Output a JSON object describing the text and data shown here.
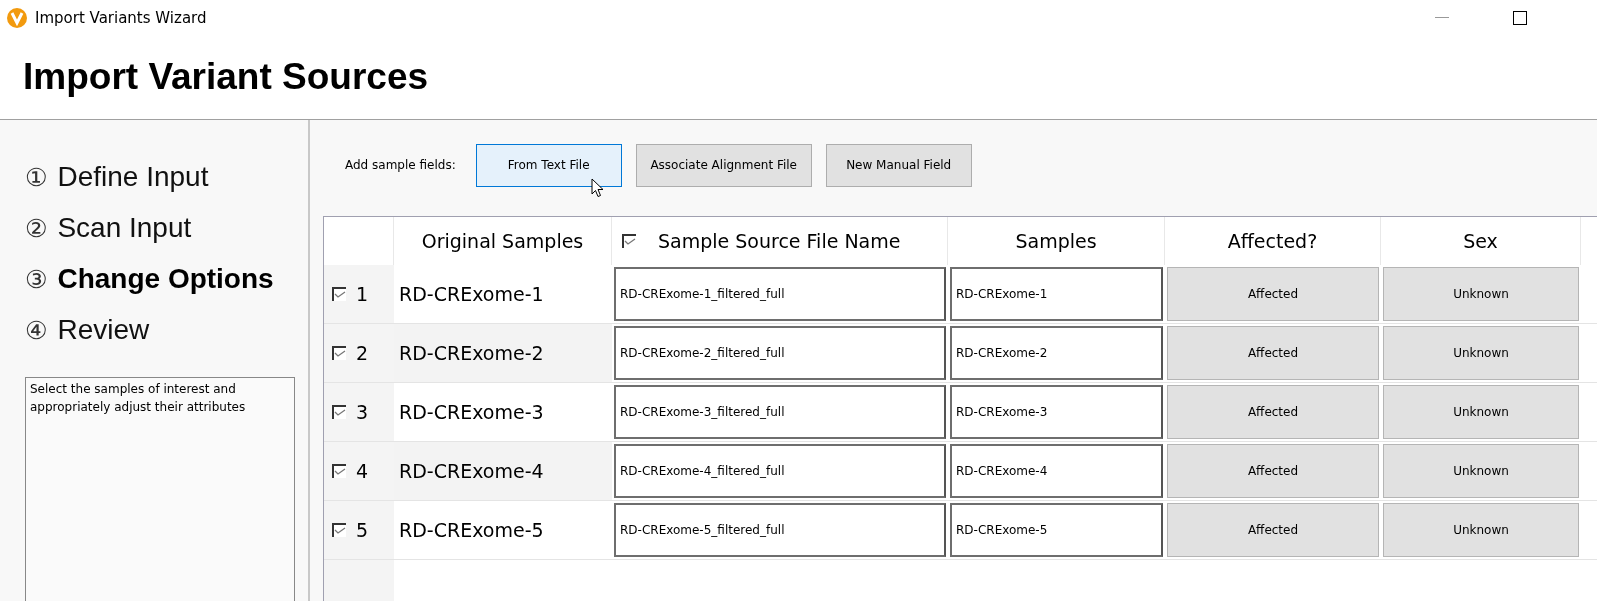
{
  "window": {
    "title": "Import Variants Wizard"
  },
  "heading": "Import Variant Sources",
  "steps": [
    {
      "number": "①",
      "label": "Define Input",
      "selected": false
    },
    {
      "number": "②",
      "label": "Scan Input",
      "selected": false
    },
    {
      "number": "③",
      "label": "Change Options",
      "selected": true
    },
    {
      "number": "④",
      "label": "Review",
      "selected": false
    }
  ],
  "help_text": "Select the samples of interest and appropriately adjust their attributes",
  "toolbar": {
    "label": "Add sample fields:",
    "buttons": [
      {
        "label": "From Text File",
        "selected": true
      },
      {
        "label": "Associate Alignment File",
        "selected": false
      },
      {
        "label": "New Manual Field",
        "selected": false
      }
    ]
  },
  "table": {
    "columns": [
      "Original Samples",
      "Sample Source File Name",
      "Samples",
      "Affected?",
      "Sex"
    ],
    "source_header_checked": true,
    "rows": [
      {
        "index": "1",
        "checked": true,
        "original": "RD-CRExome-1",
        "source_file": "RD-CRExome-1_filtered_full",
        "sample": "RD-CRExome-1",
        "affected": "Affected",
        "sex": "Unknown"
      },
      {
        "index": "2",
        "checked": true,
        "original": "RD-CRExome-2",
        "source_file": "RD-CRExome-2_filtered_full",
        "sample": "RD-CRExome-2",
        "affected": "Affected",
        "sex": "Unknown"
      },
      {
        "index": "3",
        "checked": true,
        "original": "RD-CRExome-3",
        "source_file": "RD-CRExome-3_filtered_full",
        "sample": "RD-CRExome-3",
        "affected": "Affected",
        "sex": "Unknown"
      },
      {
        "index": "4",
        "checked": true,
        "original": "RD-CRExome-4",
        "source_file": "RD-CRExome-4_filtered_full",
        "sample": "RD-CRExome-4",
        "affected": "Affected",
        "sex": "Unknown"
      },
      {
        "index": "5",
        "checked": true,
        "original": "RD-CRExome-5",
        "source_file": "RD-CRExome-5_filtered_full",
        "sample": "RD-CRExome-5",
        "affected": "Affected",
        "sex": "Unknown"
      }
    ]
  }
}
